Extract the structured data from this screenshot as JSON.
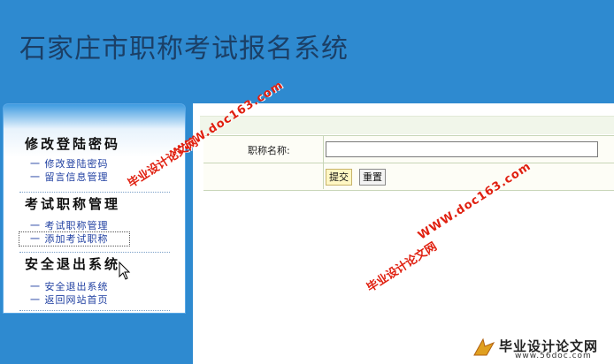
{
  "header": {
    "title": "石家庄市职称考试报名系统"
  },
  "sidebar": {
    "sections": [
      {
        "title": "修改登陆密码",
        "items": [
          "一 修改登陆密码",
          "一 留言信息管理"
        ]
      },
      {
        "title": "考试职称管理",
        "items": [
          "一 考试职称管理",
          "一 添加考试职称"
        ]
      },
      {
        "title": "安全退出系统",
        "items": [
          "一 安全退出系统",
          "一 返回网站首页"
        ]
      }
    ]
  },
  "form": {
    "label": "职称名称:",
    "input_value": "",
    "submit_label": "提交",
    "reset_label": "重置"
  },
  "watermarks": {
    "site_text": "WWW.doc163.com",
    "cn_text": "毕业设计论文网",
    "logo_text": "毕业设计论文网",
    "logo_url": "www.56doc.com"
  },
  "colors": {
    "background": "#2e8ad0",
    "title": "#1b3f66",
    "link": "#1e3ea0",
    "watermark": "#e02010"
  }
}
